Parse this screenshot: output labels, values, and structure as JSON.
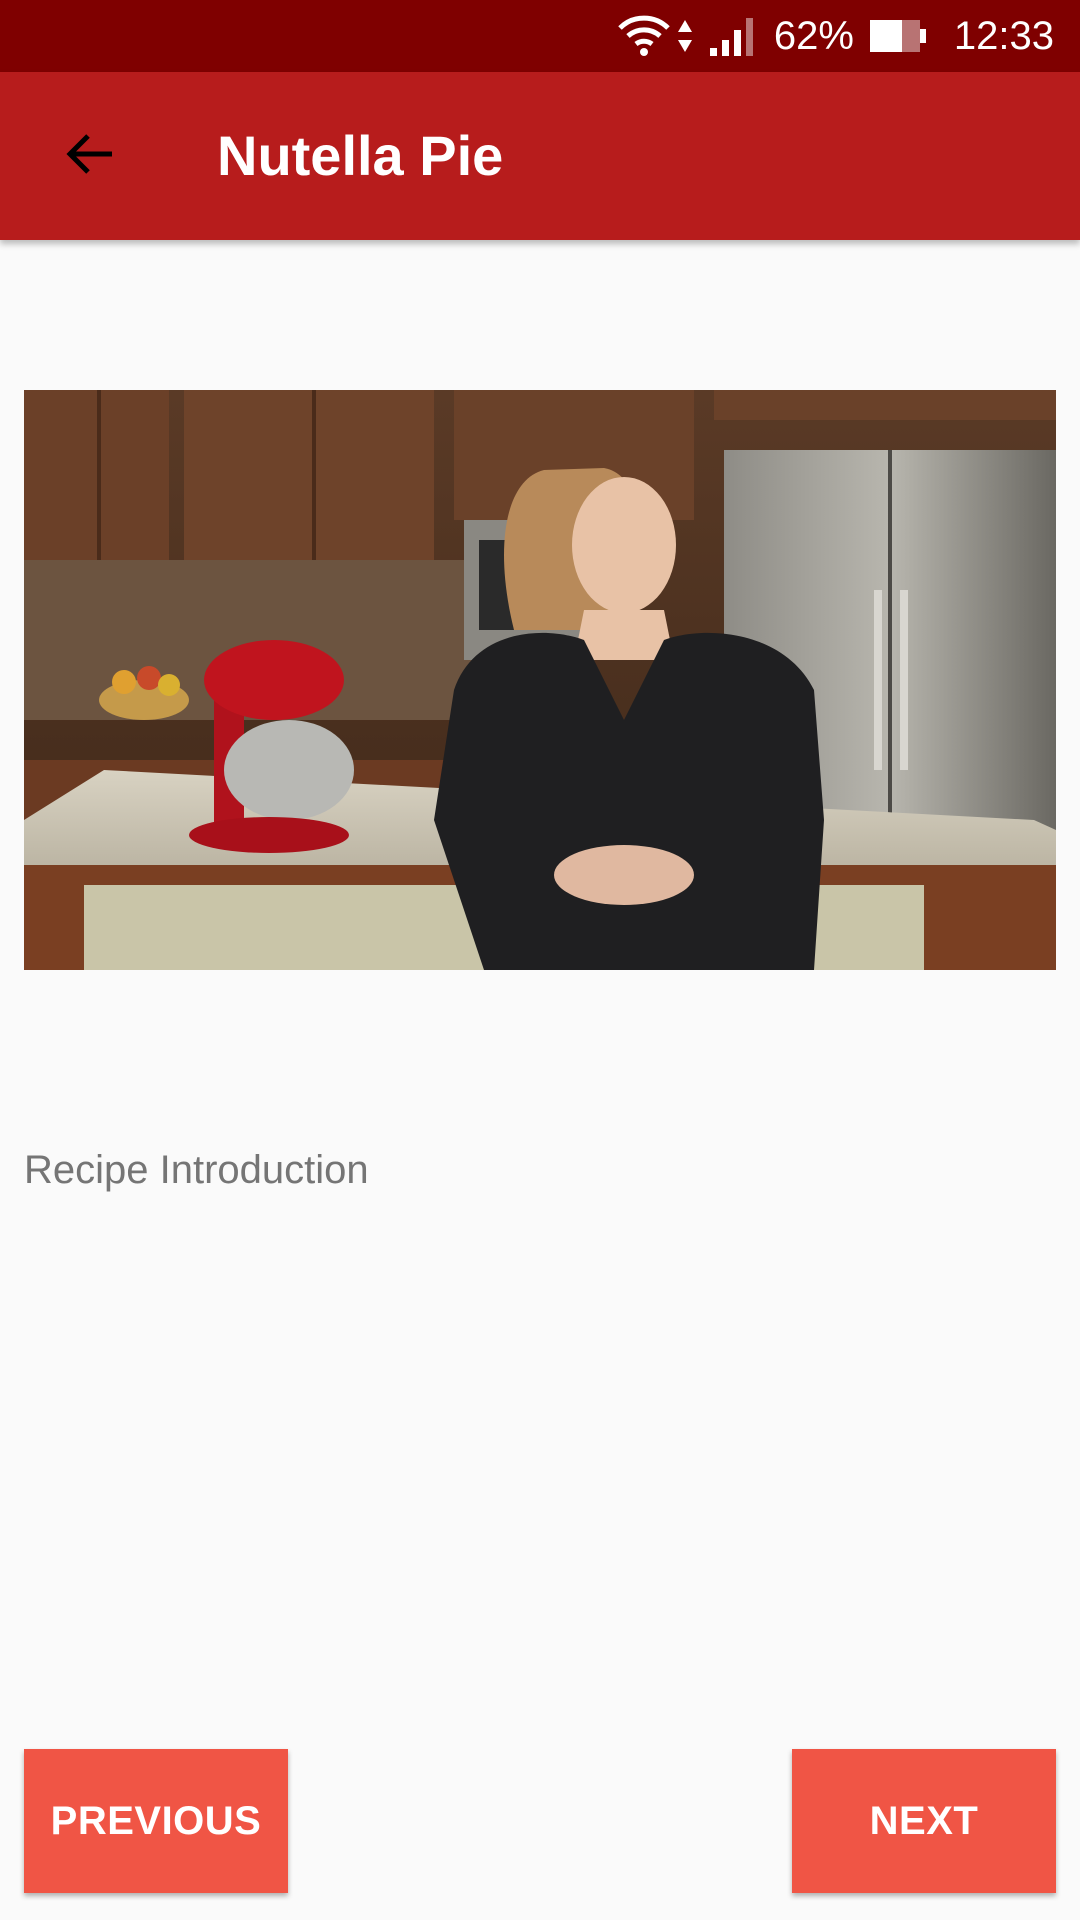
{
  "status_bar": {
    "battery_percent": "62%",
    "time": "12:33"
  },
  "app_bar": {
    "title": "Nutella Pie"
  },
  "step": {
    "description": "Recipe Introduction"
  },
  "navigation": {
    "previous_label": "PREVIOUS",
    "next_label": "NEXT"
  },
  "colors": {
    "status_bar": "#7f0000",
    "app_bar": "#b71c1c",
    "button": "#f05545",
    "background": "#fafafa"
  }
}
